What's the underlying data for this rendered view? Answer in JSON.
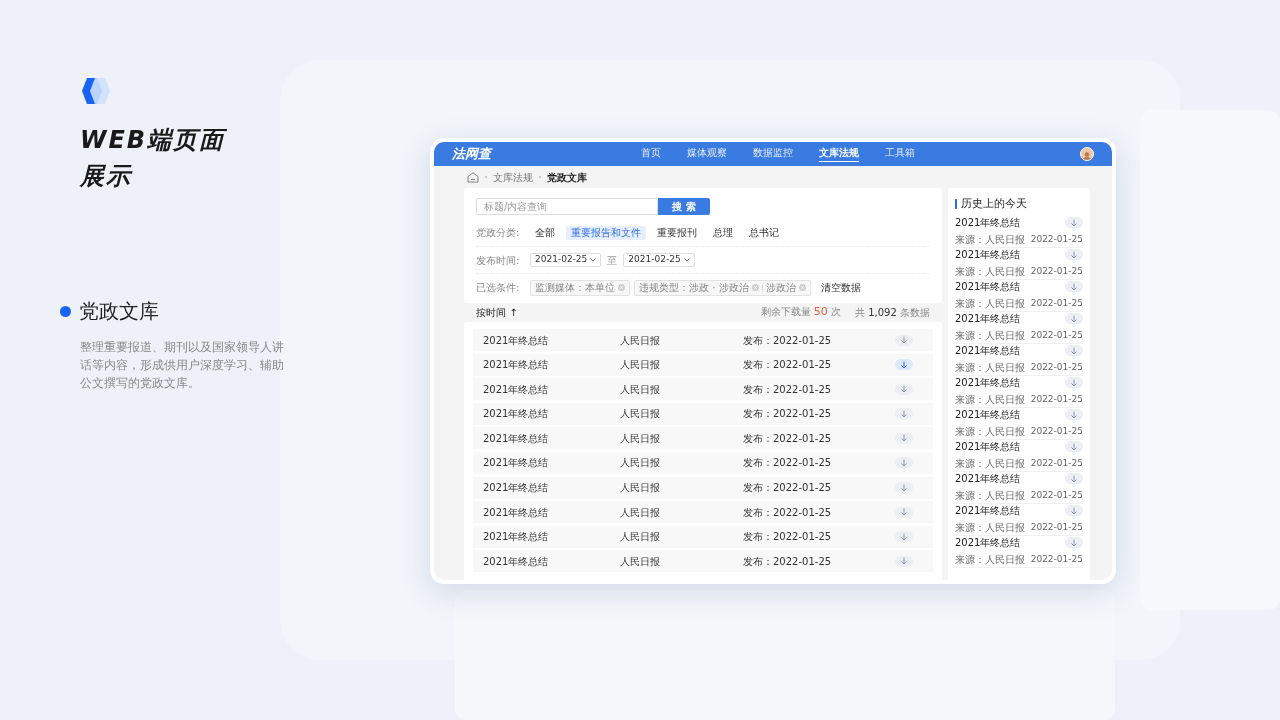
{
  "slide": {
    "title_lines": [
      "WEB端页面",
      "展示"
    ],
    "section_title": "党政文库",
    "description": "整理重要报道、期刊以及国家领导人讲话等内容，形成供用户深度学习、辅助公文撰写的党政文库。"
  },
  "app": {
    "logo": "法网查",
    "nav": [
      {
        "label": "首页",
        "selected": false
      },
      {
        "label": "媒体观察",
        "selected": false
      },
      {
        "label": "数据监控",
        "selected": false
      },
      {
        "label": "文库法规",
        "selected": true
      },
      {
        "label": "工具箱",
        "selected": false
      }
    ],
    "breadcrumb": [
      "文库法规",
      "党政文库"
    ],
    "search": {
      "placeholder": "标题/内容查询",
      "button": "搜 索"
    },
    "filters": {
      "category_label": "党政分类:",
      "categories": [
        {
          "label": "全部",
          "selected": false
        },
        {
          "label": "重要报告和文件",
          "selected": true
        },
        {
          "label": "重要报刊",
          "selected": false
        },
        {
          "label": "总理",
          "selected": false
        },
        {
          "label": "总书记",
          "selected": false
        }
      ],
      "date_label": "发布时间:",
      "date_from": "2021-02-25",
      "date_sep": "至",
      "date_to": "2021-02-25",
      "conditions_label": "已选条件:",
      "conditions": [
        {
          "parts": [
            "监测媒体：本单位"
          ]
        },
        {
          "parts": [
            "违规类型：涉政 · 涉政治",
            "涉政治"
          ]
        }
      ],
      "clear": "清空数据"
    },
    "sort": {
      "label": "按时间",
      "arrow": "↑",
      "remaining_prefix": "剩余下载量",
      "remaining": "50",
      "remaining_suffix": "次",
      "total_prefix": "共",
      "total": "1,092",
      "total_suffix": "条数据"
    },
    "rows": [
      {
        "title": "2021年终总结",
        "source": "人民日报",
        "date": "发布：2022-01-25",
        "selected": false
      },
      {
        "title": "2021年终总结",
        "source": "人民日报",
        "date": "发布：2022-01-25",
        "selected": true
      },
      {
        "title": "2021年终总结",
        "source": "人民日报",
        "date": "发布：2022-01-25",
        "selected": false
      },
      {
        "title": "2021年终总结",
        "source": "人民日报",
        "date": "发布：2022-01-25",
        "selected": false
      },
      {
        "title": "2021年终总结",
        "source": "人民日报",
        "date": "发布：2022-01-25",
        "selected": false
      },
      {
        "title": "2021年终总结",
        "source": "人民日报",
        "date": "发布：2022-01-25",
        "selected": false
      },
      {
        "title": "2021年终总结",
        "source": "人民日报",
        "date": "发布：2022-01-25",
        "selected": false
      },
      {
        "title": "2021年终总结",
        "source": "人民日报",
        "date": "发布：2022-01-25",
        "selected": false
      },
      {
        "title": "2021年终总结",
        "source": "人民日报",
        "date": "发布：2022-01-25",
        "selected": false
      },
      {
        "title": "2021年终总结",
        "source": "人民日报",
        "date": "发布：2022-01-25",
        "selected": false
      }
    ],
    "history": {
      "title": "历史上的今天",
      "items": [
        {
          "title": "2021年终总结",
          "source": "来源：人民日报",
          "date": "2022-01-25"
        },
        {
          "title": "2021年终总结",
          "source": "来源：人民日报",
          "date": "2022-01-25"
        },
        {
          "title": "2021年终总结",
          "source": "来源：人民日报",
          "date": "2022-01-25"
        },
        {
          "title": "2021年终总结",
          "source": "来源：人民日报",
          "date": "2022-01-25"
        },
        {
          "title": "2021年终总结",
          "source": "来源：人民日报",
          "date": "2022-01-25"
        },
        {
          "title": "2021年终总结",
          "source": "来源：人民日报",
          "date": "2022-01-25"
        },
        {
          "title": "2021年终总结",
          "source": "来源：人民日报",
          "date": "2022-01-25"
        },
        {
          "title": "2021年终总结",
          "source": "来源：人民日报",
          "date": "2022-01-25"
        },
        {
          "title": "2021年终总结",
          "source": "来源：人民日报",
          "date": "2022-01-25"
        },
        {
          "title": "2021年终总结",
          "source": "来源：人民日报",
          "date": "2022-01-25"
        },
        {
          "title": "2021年终总结",
          "source": "来源：人民日报",
          "date": "2022-01-25"
        }
      ]
    }
  }
}
